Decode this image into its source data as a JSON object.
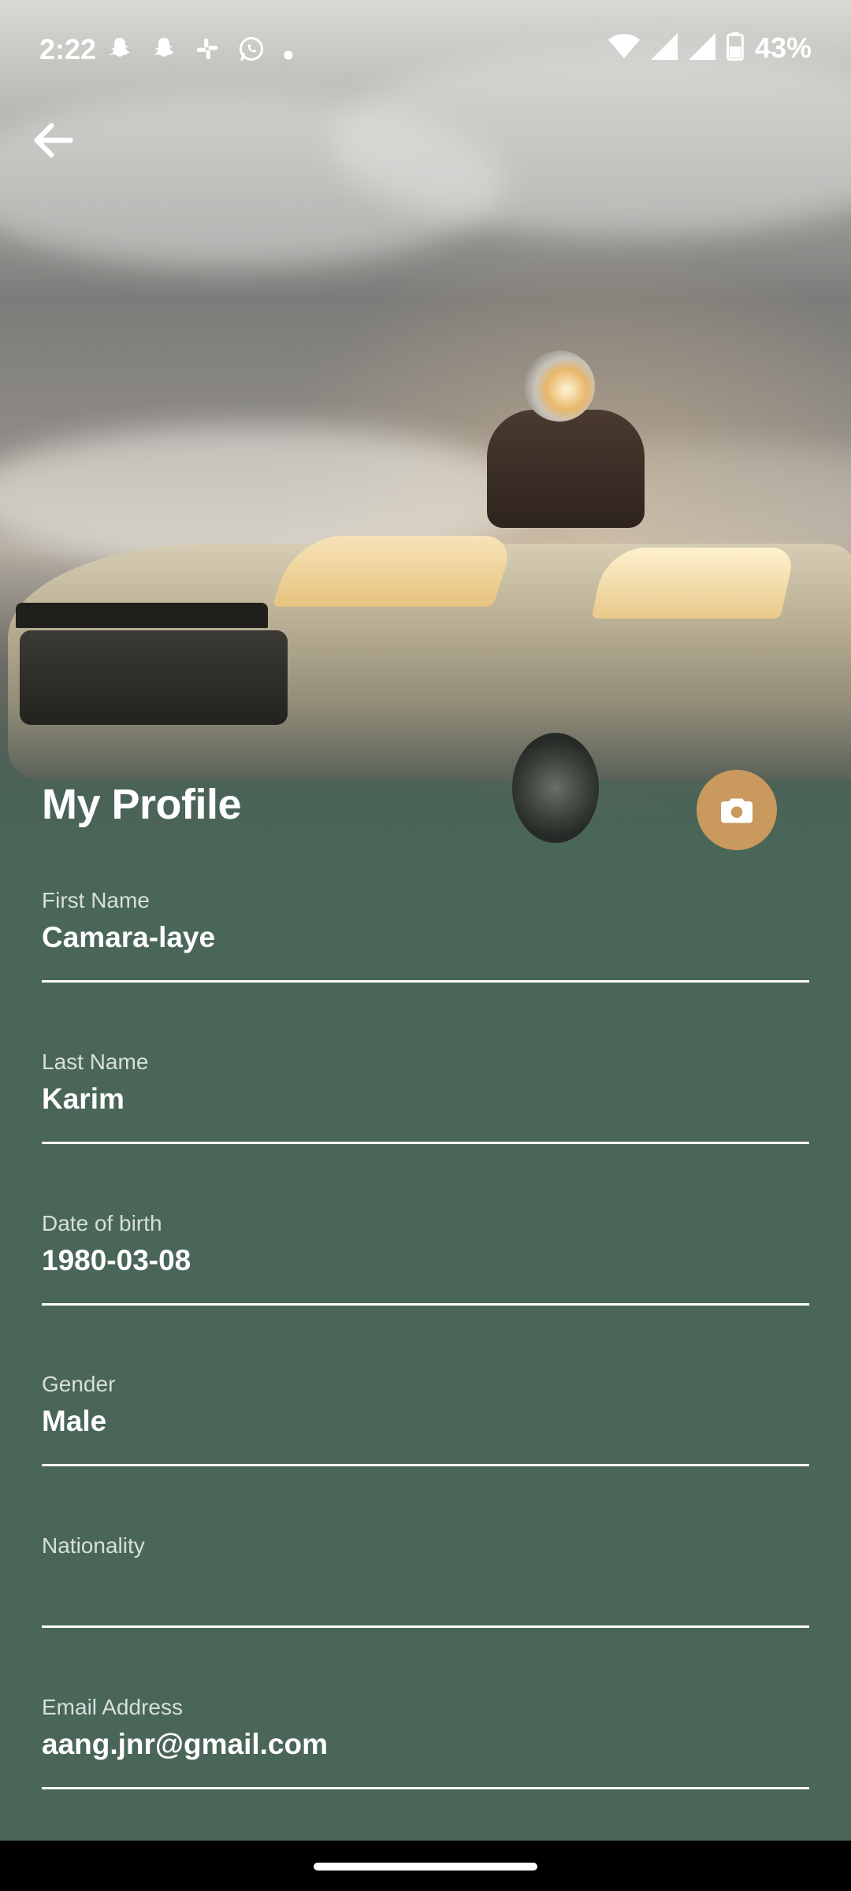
{
  "status_bar": {
    "time": "2:22",
    "notification_icons": [
      "snapchat-icon",
      "snapchat-icon",
      "slack-icon",
      "whatsapp-icon",
      "dot-icon"
    ],
    "battery": "43%"
  },
  "header": {
    "title": "My Profile"
  },
  "fields": [
    {
      "label": "First Name",
      "value": "Camara-laye"
    },
    {
      "label": "Last Name",
      "value": "Karim"
    },
    {
      "label": "Date of birth",
      "value": "1980-03-08"
    },
    {
      "label": "Gender",
      "value": "Male"
    },
    {
      "label": "Nationality",
      "value": ""
    },
    {
      "label": "Email Address",
      "value": "aang.jnr@gmail.com"
    }
  ],
  "colors": {
    "background": "#4a6659",
    "accent": "#c9995e",
    "text": "#ffffff"
  }
}
